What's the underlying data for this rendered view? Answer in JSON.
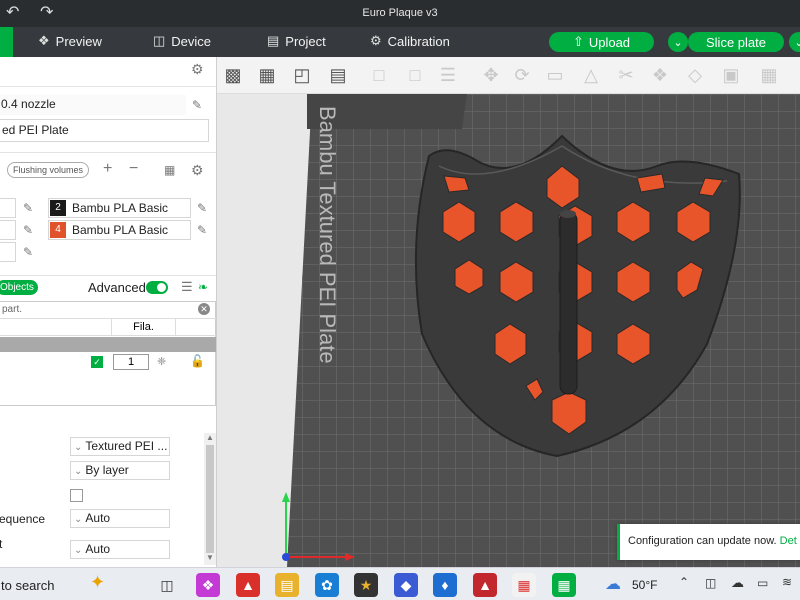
{
  "window": {
    "title": "Euro Plaque v3"
  },
  "menu": {
    "tabs": [
      {
        "label": "Preview",
        "icon": "cube-icon"
      },
      {
        "label": "Device",
        "icon": "device-icon"
      },
      {
        "label": "Project",
        "icon": "project-icon"
      },
      {
        "label": "Calibration",
        "icon": "calibration-icon"
      }
    ],
    "upload_label": "Upload",
    "slice_label": "Slice plate"
  },
  "left": {
    "nozzle": "0.4 nozzle",
    "plate": "ed PEI Plate",
    "flushing_label": "Flushing volumes",
    "filaments": [
      {
        "number": "2",
        "name": "Bambu PLA Basic",
        "color": "#1a1a1a"
      },
      {
        "number": "4",
        "name": "Bambu PLA Basic",
        "color": "#e0522a"
      }
    ],
    "objects_label": "Objects",
    "advanced_label": "Advanced",
    "search_placeholder": "part.",
    "table_header_fila": "Fila.",
    "object_filament": "1",
    "settings": {
      "plate_type": "Textured PEI ...",
      "by_layer": "By layer",
      "sequence_label": "equence",
      "sequence_value": "Auto",
      "t_label": "t",
      "t_value": "Auto"
    }
  },
  "viewport": {
    "plate_label": "Bambu Textured PEI Plate"
  },
  "toast": {
    "text": "Configuration can update now.",
    "link": "Det"
  },
  "taskbar": {
    "search": "to search",
    "weather": "50°F"
  },
  "colors": {
    "accent": "#00ae42",
    "plaque_body": "#3a3a3a",
    "plaque_inlay": "#e8552a"
  }
}
